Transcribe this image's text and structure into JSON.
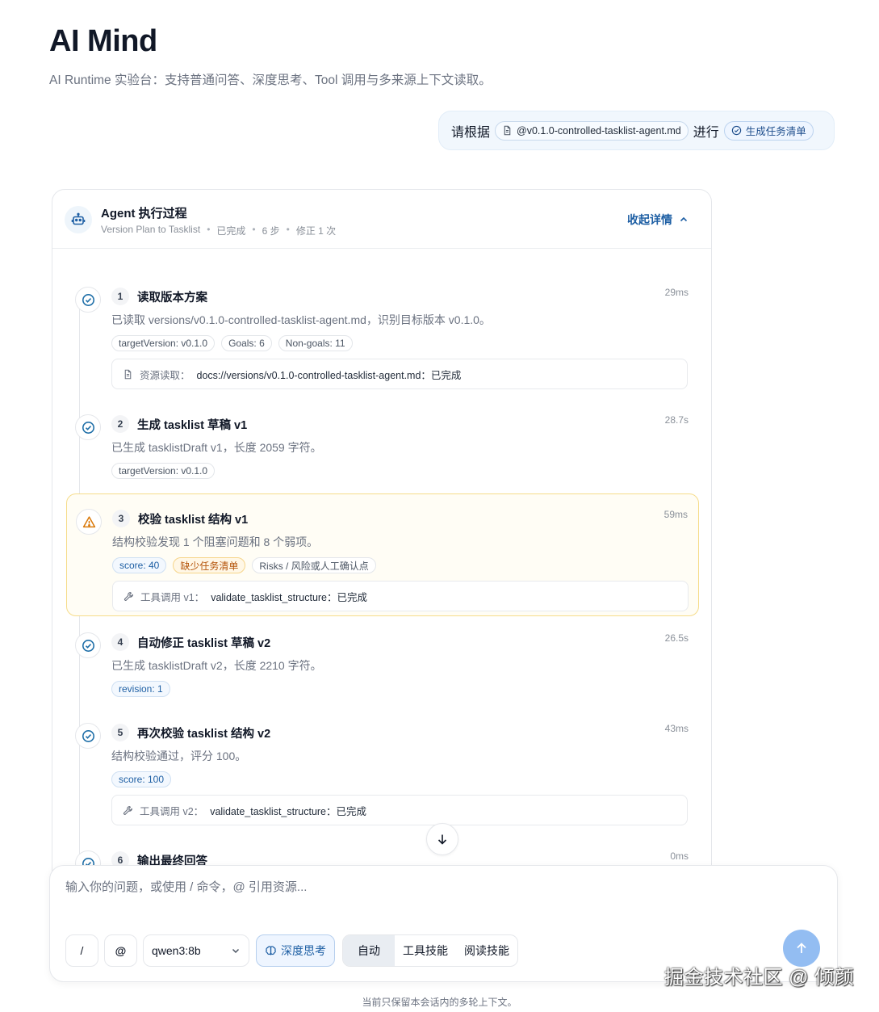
{
  "page": {
    "title": "AI Mind",
    "subtitle": "AI Runtime 实验台：支持普通问答、深度思考、Tool 调用与多来源上下文读取。"
  },
  "user_message": {
    "prefix": "请根据",
    "resource_chip": "@v0.1.0-controlled-tasklist-agent.md",
    "middle": "进行",
    "skill_chip": "生成任务清单"
  },
  "agent": {
    "title": "Agent 执行过程",
    "meta": [
      "Version Plan to Tasklist",
      "已完成",
      "6 步",
      "修正 1 次"
    ],
    "collapse_label": "收起详情",
    "steps": [
      {
        "num": "1",
        "title": "读取版本方案",
        "time": "29ms",
        "desc": "已读取 versions/v0.1.0-controlled-tasklist-agent.md，识别目标版本 v0.1.0。",
        "tags": [
          "targetVersion: v0.1.0",
          "Goals: 6",
          "Non-goals: 11"
        ],
        "box_label": "资源读取：",
        "box_value": "docs://versions/v0.1.0-controlled-tasklist-agent.md：已完成",
        "status": "done"
      },
      {
        "num": "2",
        "title": "生成 tasklist 草稿 v1",
        "time": "28.7s",
        "desc": "已生成 tasklistDraft v1，长度 2059 字符。",
        "tags": [
          "targetVersion: v0.1.0"
        ],
        "status": "done"
      },
      {
        "num": "3",
        "title": "校验 tasklist 结构 v1",
        "time": "59ms",
        "desc": "结构校验发现 1 个阻塞问题和 8 个弱项。",
        "tags": [
          "score: 40",
          "缺少任务清单",
          "Risks / 风险或人工确认点"
        ],
        "box_label": "工具调用 v1：",
        "box_value": "validate_tasklist_structure：已完成",
        "status": "warning"
      },
      {
        "num": "4",
        "title": "自动修正 tasklist 草稿 v2",
        "time": "26.5s",
        "desc": "已生成 tasklistDraft v2，长度 2210 字符。",
        "tags": [
          "revision: 1"
        ],
        "status": "done"
      },
      {
        "num": "5",
        "title": "再次校验 tasklist 结构 v2",
        "time": "43ms",
        "desc": "结构校验通过，评分 100。",
        "tags": [
          "score: 100"
        ],
        "box_label": "工具调用 v2：",
        "box_value": "validate_tasklist_structure：已完成",
        "status": "done"
      },
      {
        "num": "6",
        "title": "输出最终回答",
        "time": "0ms",
        "status": "done"
      }
    ]
  },
  "composer": {
    "placeholder": "输入你的问题，或使用 / 命令，@ 引用资源...",
    "slash_label": "/",
    "at_label": "@",
    "model": "qwen3:8b",
    "think_label": "深度思考",
    "modes": [
      "自动",
      "工具技能",
      "阅读技能"
    ],
    "active_mode": "自动"
  },
  "footer_note": "当前只保留本会话内的多轮上下文。",
  "watermark": "掘金技术社区 @ 倾颜",
  "colors": {
    "accent": "#1e5fa4",
    "success": "#1f6fa8",
    "warning": "#d97706",
    "send_button": "#93bdf2"
  }
}
